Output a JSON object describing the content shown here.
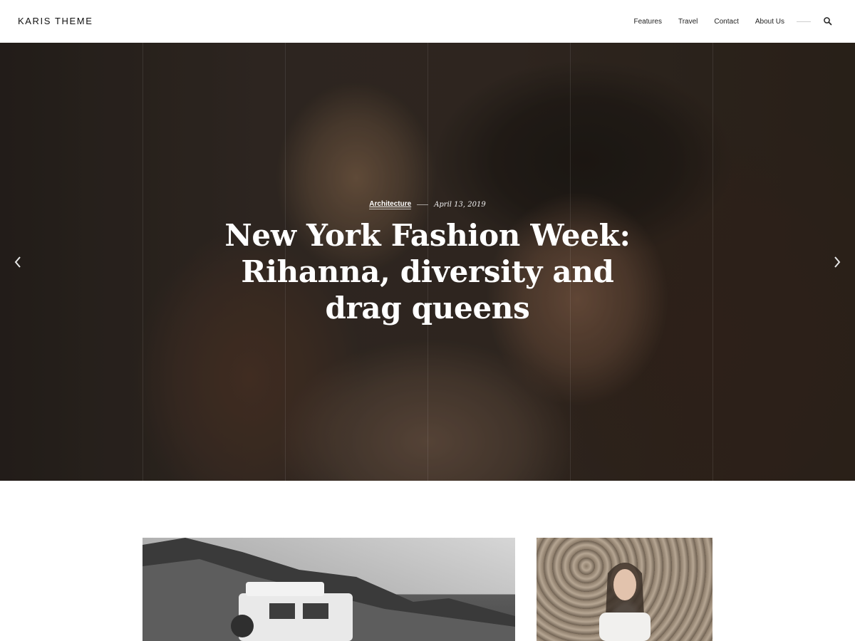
{
  "header": {
    "logo": "KARIS THEME",
    "nav": [
      "Features",
      "Travel",
      "Contact",
      "About Us"
    ],
    "search_icon": "search-icon"
  },
  "hero": {
    "category": "Architecture",
    "date": "April 13, 2019",
    "title": "New York Fashion Week: Rihanna, diversity and drag queens",
    "prev_icon": "chevron-left-icon",
    "next_icon": "chevron-right-icon"
  },
  "colors": {
    "background": "#ffffff",
    "text": "#1a1a1a",
    "hero_text": "#ffffff"
  }
}
